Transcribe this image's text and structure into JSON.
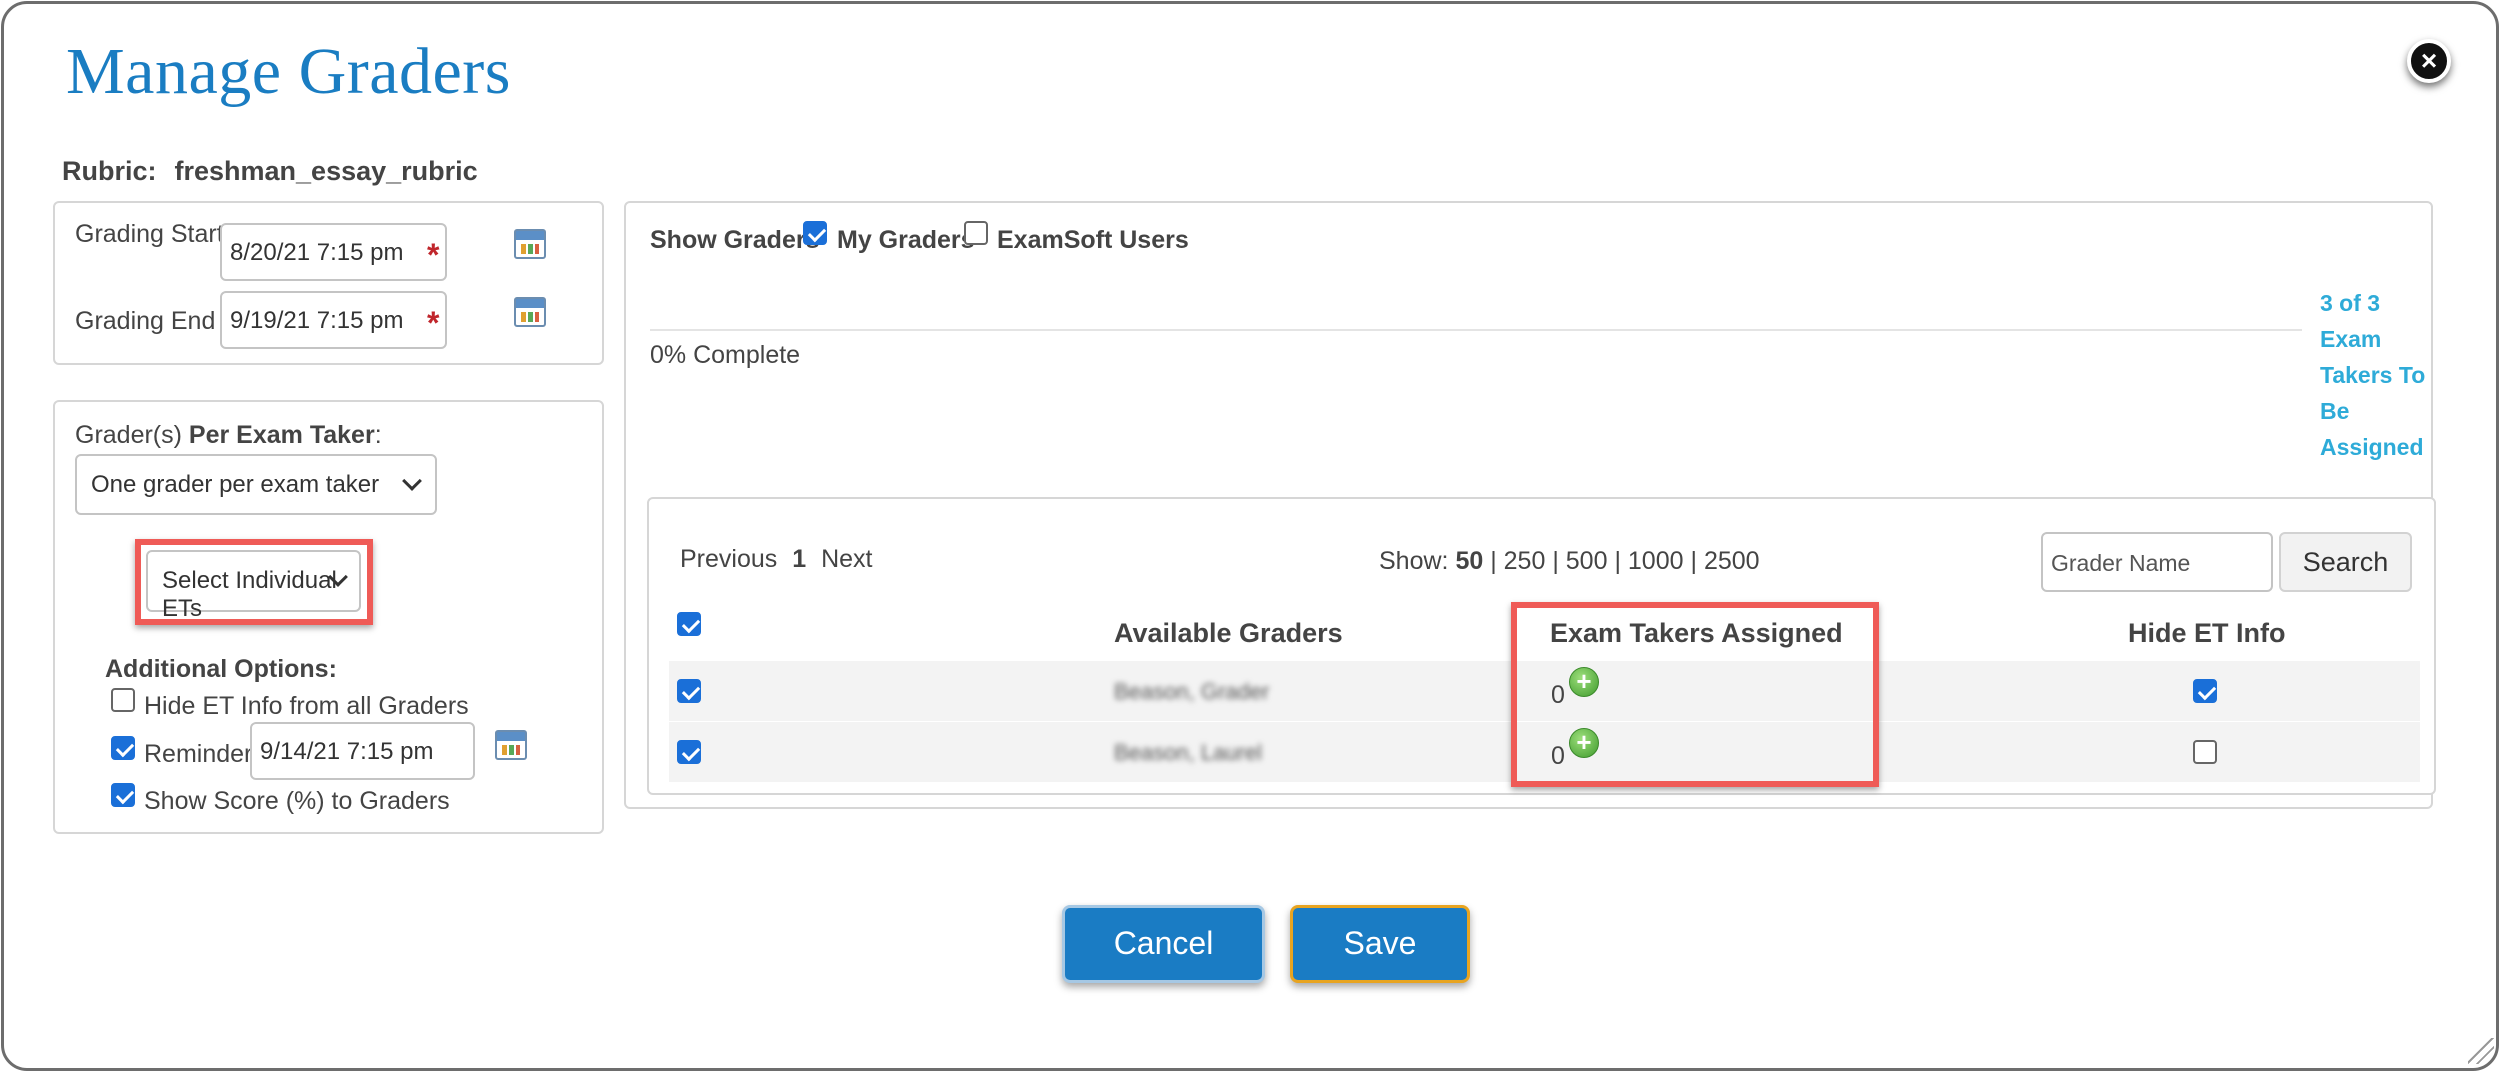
{
  "dialog": {
    "title": "Manage Graders",
    "close_label": "×"
  },
  "rubric": {
    "label": "Rubric:",
    "value": "freshman_essay_rubric"
  },
  "dates": {
    "start_label": "Grading Start",
    "start_value": "8/20/21 7:15 pm",
    "end_label": "Grading End",
    "end_value": "9/19/21 7:15 pm",
    "required_mark": "*"
  },
  "graders_per_taker": {
    "label_plain": "Grader(s) ",
    "label_bold": "Per Exam Taker",
    "label_suffix": ":",
    "selected": "One grader per exam taker",
    "et_select": "Select Individual ETs"
  },
  "additional_options": {
    "heading": "Additional Options:",
    "hide_et_info": {
      "label": "Hide ET Info from all Graders",
      "checked": false
    },
    "reminder": {
      "label": "Reminder:",
      "checked": true,
      "value": "9/14/21 7:15 pm"
    },
    "show_score": {
      "label": "Show Score (%) to Graders",
      "checked": true
    }
  },
  "show_graders": {
    "label": "Show Graders",
    "my_graders": {
      "label": "My Graders",
      "checked": true
    },
    "examsoft_users": {
      "label": "ExamSoft Users",
      "checked": false
    }
  },
  "progress": {
    "text": "0% Complete",
    "percent": 0,
    "assign_status": [
      "3 of 3",
      "Exam",
      "Takers To",
      "Be",
      "Assigned"
    ]
  },
  "pagination": {
    "previous": "Previous",
    "page": "1",
    "next": "Next",
    "show_label": "Show:",
    "options": [
      "50",
      "250",
      "500",
      "1000",
      "2500"
    ],
    "selected": "50",
    "separator": "|"
  },
  "search": {
    "placeholder": "Grader Name",
    "button": "Search"
  },
  "table": {
    "columns": [
      "Available Graders",
      "Exam Takers Assigned",
      "Hide ET Info"
    ],
    "select_all_checked": true,
    "rows": [
      {
        "selected": true,
        "name": "Beason, Grader",
        "assigned": "0",
        "hide_et": true
      },
      {
        "selected": true,
        "name": "Beason, Laurel",
        "assigned": "0",
        "hide_et": false
      }
    ]
  },
  "footer": {
    "cancel": "Cancel",
    "save": "Save"
  },
  "colors": {
    "title_blue": "#1a7dc2",
    "button_blue": "#1a7cc4",
    "highlight_red": "#ef5b57",
    "link_cyan": "#2eabd8",
    "save_border": "#e8a420"
  },
  "icons": [
    "close-icon",
    "calendar-icon",
    "chevron-down-icon",
    "checkbox-icon",
    "add-circle-icon",
    "resize-grip-icon"
  ]
}
